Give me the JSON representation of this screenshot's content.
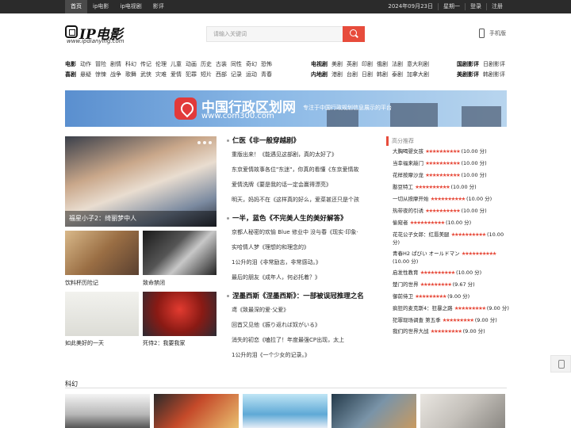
{
  "topbar": {
    "left": [
      "首页",
      "ip电影",
      "ip电视剧",
      "影评"
    ],
    "right": [
      "2024年09月23日",
      "星期一",
      "登录",
      "注册"
    ]
  },
  "logo": {
    "title": "IP电影",
    "url_text": "www.ipdianying.com"
  },
  "search": {
    "placeholder": "请输入关键词"
  },
  "mobile": {
    "label": "手机版"
  },
  "nav": {
    "g1": {
      "r1": [
        "电影",
        "动作",
        "冒险",
        "剧情",
        "科幻",
        "传记",
        "伦理",
        "儿童",
        "动画",
        "历史",
        "古装",
        "同性",
        "奇幻",
        "恐怖"
      ],
      "r2": [
        "喜剧",
        "悬疑",
        "惊悚",
        "战争",
        "歌舞",
        "武侠",
        "灾难",
        "爱情",
        "犯罪",
        "短片",
        "西部",
        "记录",
        "运动",
        "青春"
      ]
    },
    "g2": {
      "r1": [
        "电视剧",
        "美剧",
        "英剧",
        "印剧",
        "俄剧",
        "法剧",
        "意大利剧"
      ],
      "r2": [
        "内地剧",
        "港剧",
        "台剧",
        "日剧",
        "韩剧",
        "泰剧",
        "加拿大剧"
      ]
    },
    "g3": {
      "r1": [
        "国剧影评",
        "日剧影评"
      ],
      "r2": [
        "美剧影评",
        "韩剧影评"
      ]
    }
  },
  "banner": {
    "title": "中国行政区划网",
    "url": "www.com300.com",
    "slogan": "专注于中国行政规划信息展示的平台"
  },
  "featured": {
    "caption": "福星小子2：绮丽梦中人"
  },
  "thumbs": [
    "饮料杯历险记",
    "致命禁闭",
    "如此美好的一天",
    "死侍2：我要我家"
  ],
  "sections": [
    {
      "head": "仁医《非一般穿越剧》",
      "items": [
        "重版出来！《能遇见这部剧，真的太好了》",
        "东京爱情故事各位\"东迷\"，你真的看懂《东京爱情故",
        "爱情洗牌《要是我的话一定会赢得漂亮》",
        "明天，妈妈不在《这样真的好么，爱菜甚还只是个孩"
      ]
    },
    {
      "head": "一半，蓝色《不完美人生的美好解答》",
      "items": [
        "京都人秘密的欢愉 Blue 修业中 没与春《现实·印象·",
        "实哈情人梦《理想的和理念的》",
        "1公升的泪《非常励志，非常感动。》",
        "最后的朋友《成年人，何必托着？》"
      ]
    },
    {
      "head": "涅墨西斯《涅墨西斯》：一部被误冠推理之名",
      "items": [
        "鸢《致最深的爱·父爱》",
        "回首又见他《振り返れば奴がいる》",
        "消失的初恋《嗑拉了！年度最强CP出现，太上",
        "1公升的泪《一个少女的记录。》"
      ]
    }
  ],
  "rank": {
    "title": "高分推荐",
    "items": [
      {
        "name": "大胸喝婴女孩",
        "score": "(10.00 分)"
      },
      {
        "name": "当幸福来敲门",
        "score": "(10.00 分)"
      },
      {
        "name": "花样按摩沙龙",
        "score": "(10.00 分)"
      },
      {
        "name": "憨豆特工",
        "score": "(10.00 分)"
      },
      {
        "name": "一切从按摩开始",
        "score": "(10.00 分)"
      },
      {
        "name": "热带夜的引诱",
        "score": "(10.00 分)"
      },
      {
        "name": "偷窥者",
        "score": "(10.00 分)"
      },
      {
        "name": "花花公子女郎：红唇美腿",
        "score": "(10.00 分)"
      },
      {
        "name": "青春H2 ぱびい オールドマン",
        "score": "(10.00 分)"
      },
      {
        "name": "启发性教育",
        "score": "(10.00 分)"
      },
      {
        "name": "楚门的世界",
        "score": "(9.67 分)"
      },
      {
        "name": "御前侍卫",
        "score": "(9.00 分)"
      },
      {
        "name": "疯狂的麦克斯4：狂暴之路",
        "score": "(9.00 分)"
      },
      {
        "name": "犯罪现场调查 第五季",
        "score": "(9.00 分)"
      },
      {
        "name": "我们的世界大战",
        "score": "(9.00 分)"
      }
    ]
  },
  "scifi": {
    "label": "科幻"
  },
  "colors": {
    "accent": "#e74c3c",
    "topbar": "#2b2b2b"
  }
}
